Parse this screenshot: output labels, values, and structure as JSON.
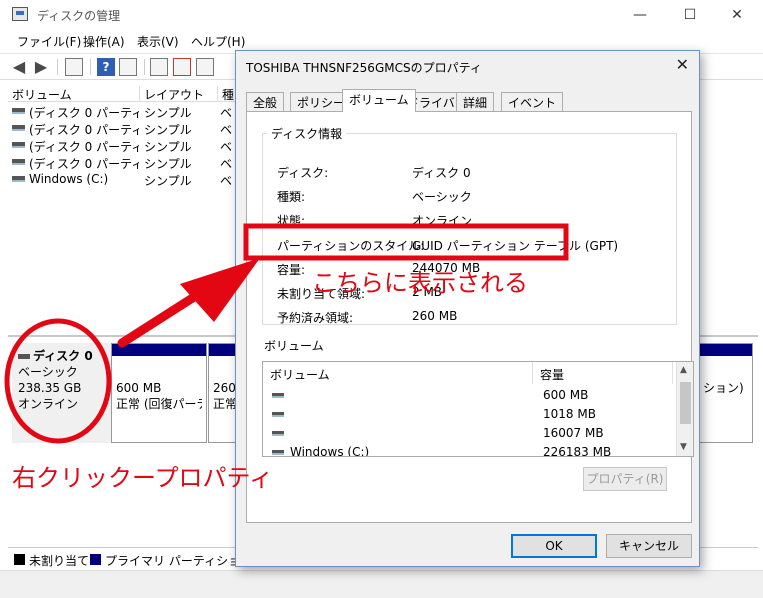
{
  "window": {
    "title": "ディスクの管理",
    "controls": {
      "minimize": "—",
      "maximize": "☐",
      "close": "✕"
    }
  },
  "menu": [
    "ファイル(F)",
    "操作(A)",
    "表示(V)",
    "ヘルプ(H)"
  ],
  "volume_list": {
    "headers": [
      "ボリューム",
      "レイアウト",
      "種"
    ],
    "rows": [
      {
        "name": "(ディスク 0 パーティシ...",
        "layout": "シンプル",
        "type": "ベ"
      },
      {
        "name": "(ディスク 0 パーティシ...",
        "layout": "シンプル",
        "type": "ベ"
      },
      {
        "name": "(ディスク 0 パーティシ...",
        "layout": "シンプル",
        "type": "ベ"
      },
      {
        "name": "(ディスク 0 パーティシ...",
        "layout": "シンプル",
        "type": "ベ"
      },
      {
        "name": "Windows (C:)",
        "layout": "シンプル",
        "type": "ベ"
      }
    ]
  },
  "disk": {
    "title": "ディスク 0",
    "type": "ベーシック",
    "size": "238.35 GB",
    "status": "オンライン",
    "partitions": [
      {
        "line1": "600 MB",
        "line2": "正常 (回復パーテ"
      },
      {
        "line1": "260",
        "line2": "正常"
      },
      {
        "line1": "",
        "line2": "ション)"
      }
    ]
  },
  "legend": [
    {
      "label": "未割り当て",
      "color": "#000000"
    },
    {
      "label": "プライマリ パーティション",
      "color": "#00007f"
    }
  ],
  "dialog": {
    "title": "TOSHIBA THNSNF256GMCSのプロパティ",
    "close": "✕",
    "tabs": [
      "全般",
      "ポリシー",
      "ボリューム",
      "ドライバー",
      "詳細",
      "イベント"
    ],
    "active_tab": "ボリューム",
    "group_title": "ディスク情報",
    "props": [
      {
        "label": "ディスク:",
        "value": "ディスク 0"
      },
      {
        "label": "種類:",
        "value": "ベーシック"
      },
      {
        "label": "状態:",
        "value": "オンライン"
      },
      {
        "label": "パーティションのスタイル:",
        "value": "GUID パーティション テーブル (GPT)"
      },
      {
        "label": "容量:",
        "value": "244070 MB"
      },
      {
        "label": "未割り当て領域:",
        "value": "2 MB"
      },
      {
        "label": "予約済み領域:",
        "value": "260 MB"
      }
    ],
    "volumes_label": "ボリューム",
    "vol_headers": [
      "ボリューム",
      "容量"
    ],
    "vol_rows": [
      {
        "name": "",
        "size": "600 MB"
      },
      {
        "name": "",
        "size": "1018 MB"
      },
      {
        "name": "",
        "size": "16007 MB"
      },
      {
        "name": "Windows (C:)",
        "size": "226183 MB"
      }
    ],
    "properties_button": "プロパティ(R)",
    "ok_button": "OK",
    "cancel_button": "キャンセル"
  },
  "annotations": {
    "right_click": "右クリックープロパティ",
    "shown_here": "こちらに表示される",
    "color": "#e30613"
  }
}
